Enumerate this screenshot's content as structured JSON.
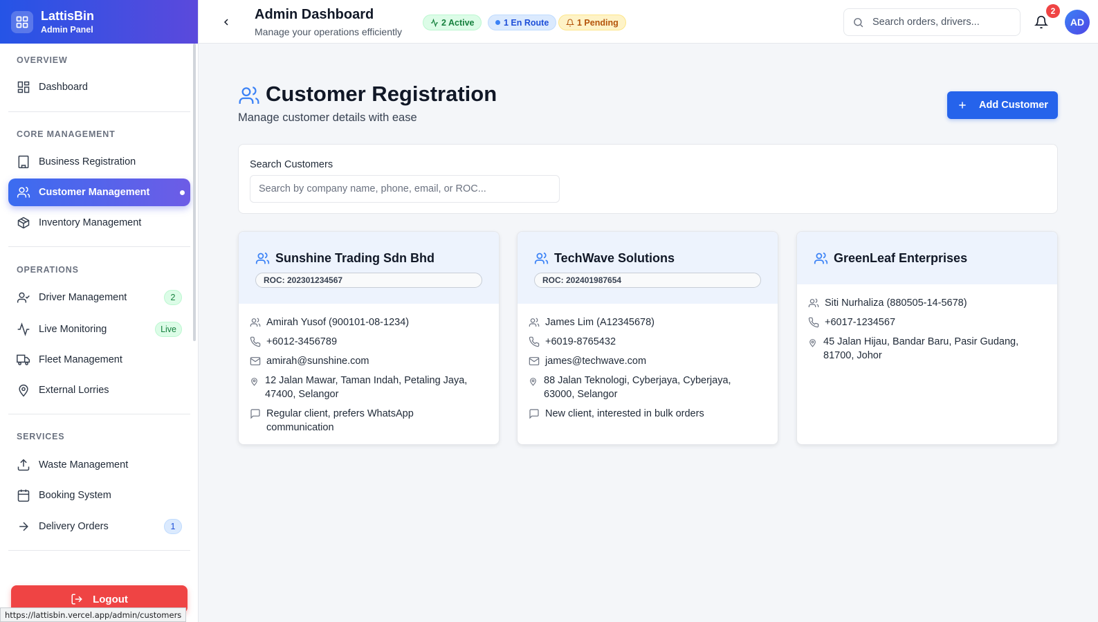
{
  "brand": {
    "name": "LattisBin",
    "subtitle": "Admin Panel"
  },
  "sidebar": {
    "sections": {
      "overview": "OVERVIEW",
      "core": "CORE MANAGEMENT",
      "operations": "OPERATIONS",
      "services": "SERVICES"
    },
    "items": {
      "dashboard": "Dashboard",
      "business": "Business Registration",
      "customer": "Customer Management",
      "inventory": "Inventory Management",
      "driver": "Driver Management",
      "driver_badge": "2",
      "live": "Live Monitoring",
      "live_badge": "Live",
      "fleet": "Fleet Management",
      "lorries": "External Lorries",
      "waste": "Waste Management",
      "booking": "Booking System",
      "delivery": "Delivery Orders",
      "delivery_badge": "1"
    },
    "logout": "Logout"
  },
  "status_bar": {
    "url": "https://lattisbin.vercel.app/admin/customers"
  },
  "header": {
    "title": "Admin Dashboard",
    "subtitle": "Manage your operations efficiently",
    "chips": {
      "active": "2 Active",
      "en_route": "1 En Route",
      "pending": "1 Pending"
    },
    "search_placeholder": "Search orders, drivers...",
    "notification_count": "2",
    "avatar": "AD"
  },
  "page": {
    "title": "Customer Registration",
    "subtitle": "Manage customer details with ease",
    "add_button": "Add Customer",
    "search_label": "Search Customers",
    "search_placeholder": "Search by company name, phone, email, or ROC..."
  },
  "customers": [
    {
      "company": "Sunshine Trading Sdn Bhd",
      "roc": "ROC: 202301234567",
      "contact": "Amirah Yusof (900101-08-1234)",
      "phone": "+6012-3456789",
      "email": "amirah@sunshine.com",
      "address_line1": "12 Jalan Mawar, Taman Indah, Petaling Jaya,",
      "address_line2": "47400, Selangor",
      "notes_line1": "Regular client, prefers WhatsApp",
      "notes_line2": "communication"
    },
    {
      "company": "TechWave Solutions",
      "roc": "ROC: 202401987654",
      "contact": "James Lim (A12345678)",
      "phone": "+6019-8765432",
      "email": "james@techwave.com",
      "address_line1": "88 Jalan Teknologi, Cyberjaya, Cyberjaya,",
      "address_line2": "63000, Selangor",
      "notes_line1": "New client, interested in bulk orders"
    },
    {
      "company": "GreenLeaf Enterprises",
      "contact": "Siti Nurhaliza (880505-14-5678)",
      "phone": "+6017-1234567",
      "address_line1": "45 Jalan Hijau, Bandar Baru, Pasir Gudang,",
      "address_line2": "81700, Johor"
    }
  ],
  "colors": {
    "primary": "#2563eb",
    "brand_gradient_start": "#2554e6",
    "brand_gradient_end": "#5b49dc",
    "danger": "#ef4444"
  }
}
